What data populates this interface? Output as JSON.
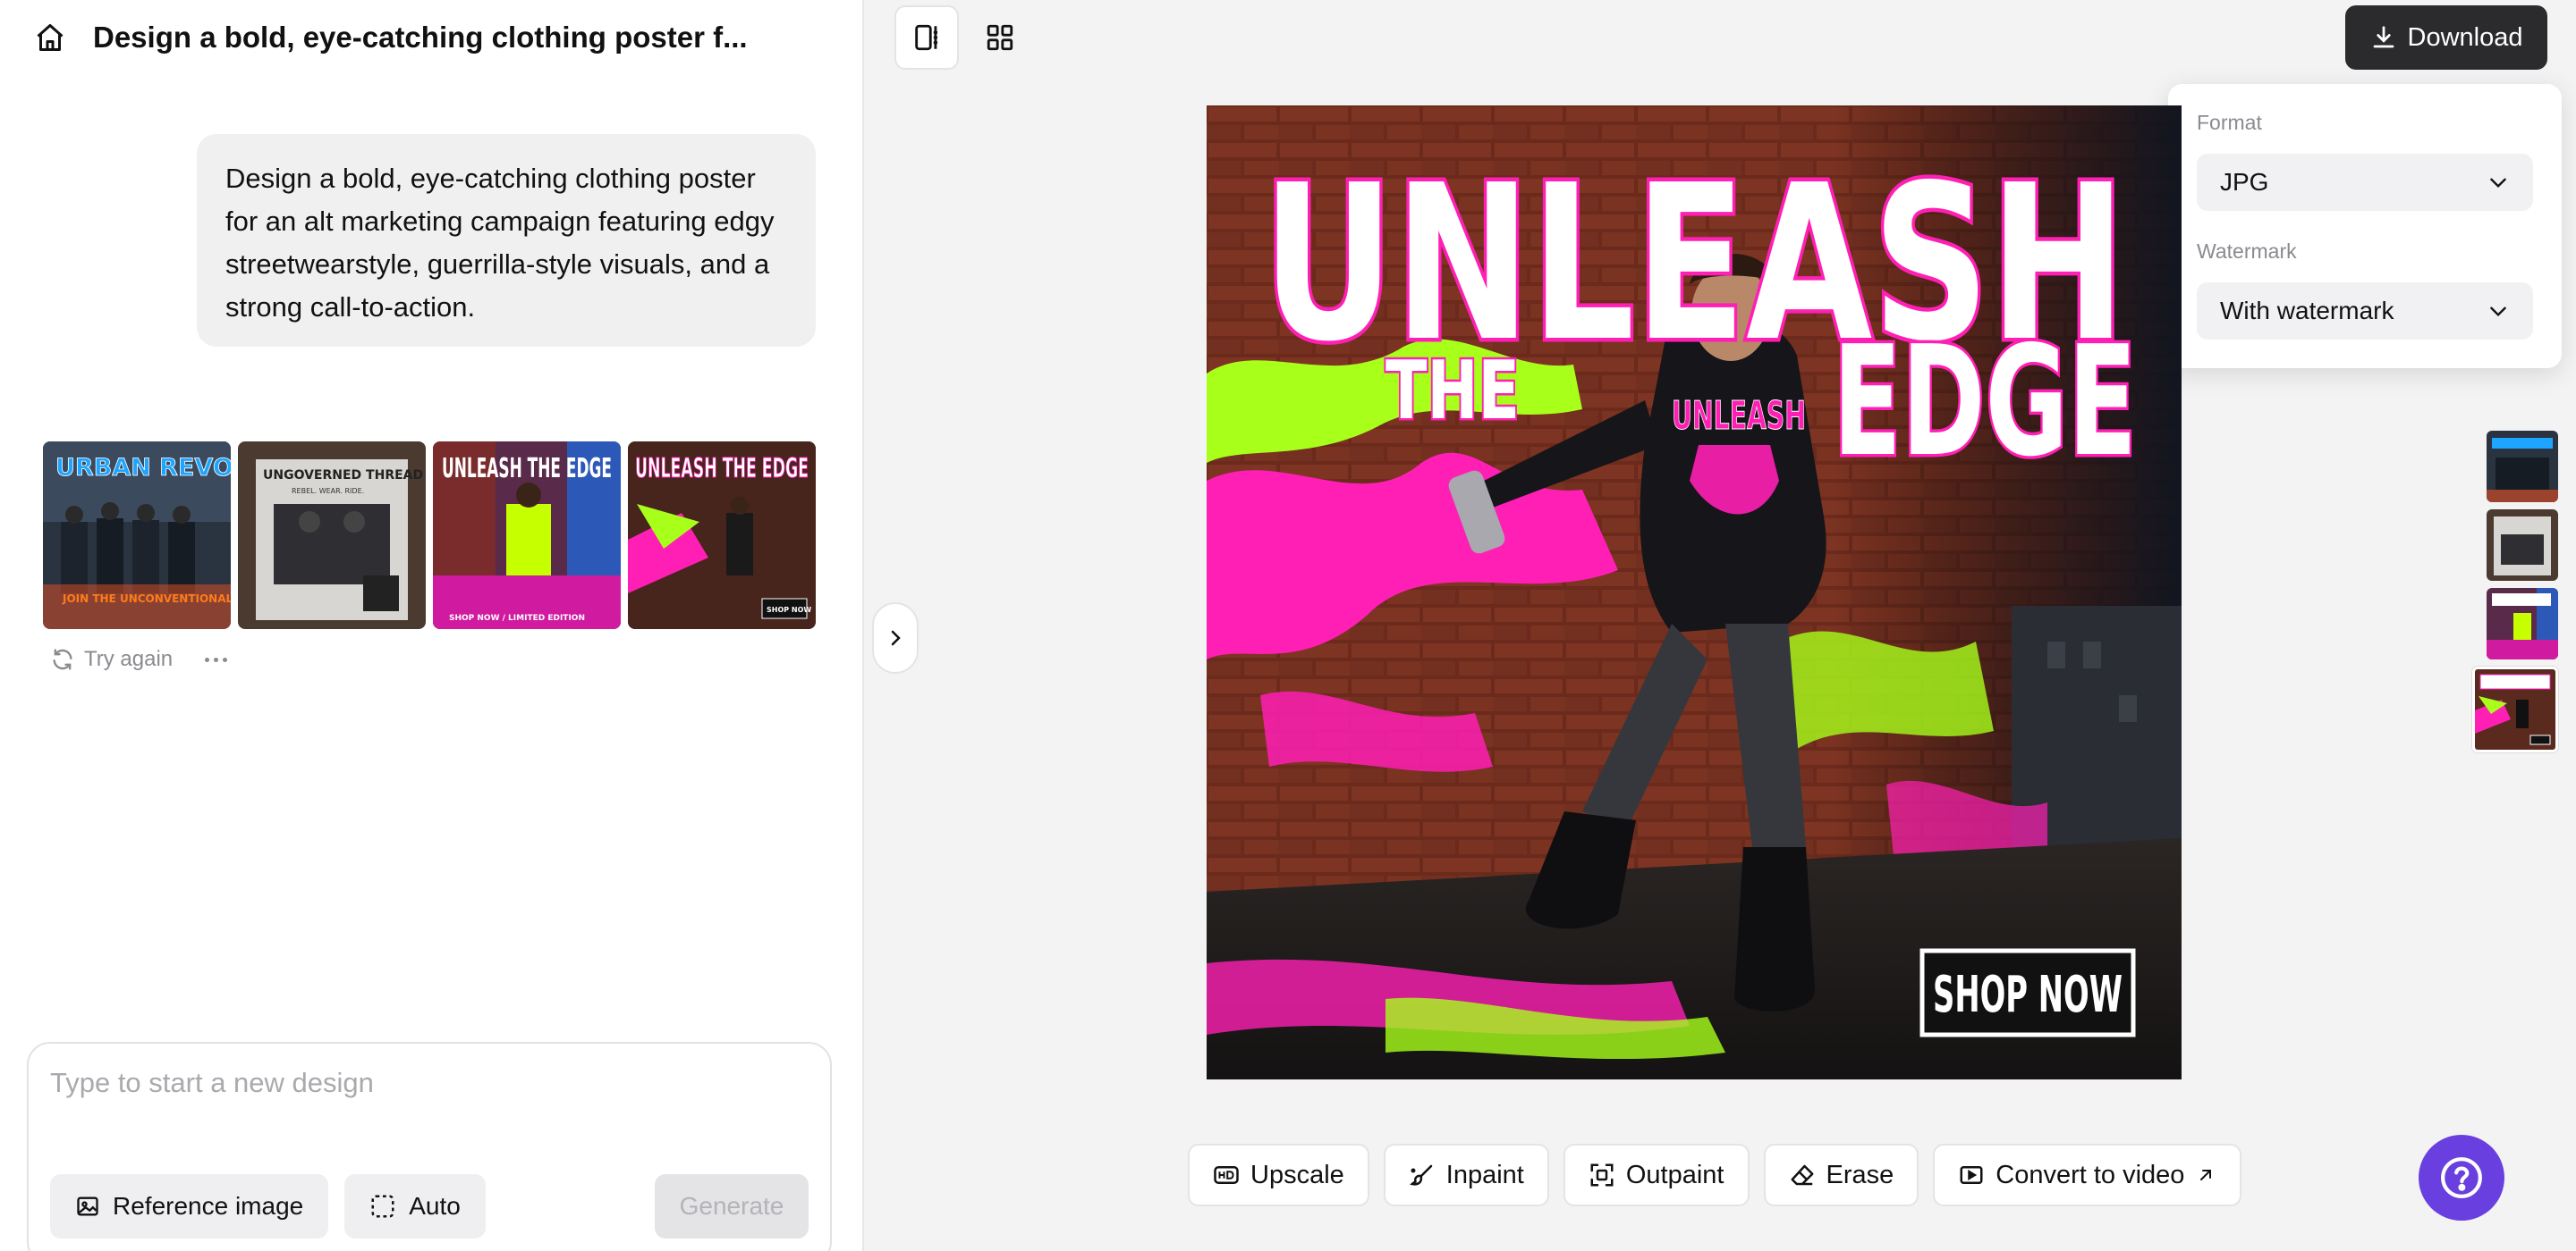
{
  "header": {
    "title": "Design a bold, eye-catching clothing poster f..."
  },
  "chat": {
    "prompt": "Design a bold, eye-catching clothing poster for an alt marketing campaign featuring edgy streetwearstyle, guerrilla-style visuals, and a strong call-to-action.",
    "results": [
      {
        "headline": "URBAN REVOL",
        "tagline": "JOIN THE UNCONVENTIONAL"
      },
      {
        "headline": "UNGOVERNED THREAD",
        "tagline": "REBEL. WEAR. RIDE."
      },
      {
        "headline": "UNLEASH THE EDGE",
        "tagline": "SHOP NOW / LIMITED EDITION"
      },
      {
        "headline": "UNLEASH THE EDGE",
        "tagline": "SHOP NOW"
      }
    ],
    "try_again_label": "Try again"
  },
  "composer": {
    "placeholder": "Type to start a new design",
    "reference_label": "Reference image",
    "auto_label": "Auto",
    "generate_label": "Generate"
  },
  "download": {
    "button_label": "Download",
    "format_label": "Format",
    "format_value": "JPG",
    "watermark_label": "Watermark",
    "watermark_value": "With watermark"
  },
  "poster": {
    "headline_line1": "UNLEASH",
    "headline_line2a": "THE",
    "headline_line2b": "EDGE",
    "hoodie_text": "UNLEASH",
    "cta": "SHOP NOW",
    "colors": {
      "pink": "#ff1fb4",
      "lime": "#a8ff1a",
      "brick": "#6b2a1c"
    }
  },
  "toolbar": {
    "upscale": "Upscale",
    "inpaint": "Inpaint",
    "outpaint": "Outpaint",
    "erase": "Erase",
    "convert": "Convert to video"
  },
  "theme": {
    "help_color": "#6a3fe0",
    "download_bg": "#2b2b2e"
  }
}
